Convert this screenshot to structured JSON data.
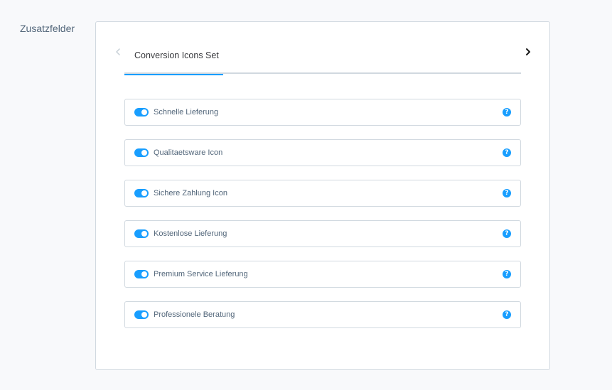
{
  "section": {
    "label": "Zusatzfelder"
  },
  "tabs": [
    {
      "label": "Conversion Icons Set",
      "active": true
    }
  ],
  "fields": [
    {
      "label": "Schnelle Lieferung",
      "enabled": true,
      "help_icon": "?"
    },
    {
      "label": "Qualitaetsware Icon",
      "enabled": true,
      "help_icon": "?"
    },
    {
      "label": "Sichere Zahlung Icon",
      "enabled": true,
      "help_icon": "?"
    },
    {
      "label": "Kostenlose Lieferung",
      "enabled": true,
      "help_icon": "?"
    },
    {
      "label": "Premium Service Lieferung",
      "enabled": true,
      "help_icon": "?"
    },
    {
      "label": "Professionele Beratung",
      "enabled": true,
      "help_icon": "?"
    }
  ],
  "icons": {
    "prev": "chevron-left-icon",
    "next": "chevron-right-icon",
    "help": "question-circle-icon"
  },
  "colors": {
    "accent": "#189eff",
    "border": "#d1d9e0",
    "text": "#52667a",
    "background": "#f8f9fb"
  }
}
